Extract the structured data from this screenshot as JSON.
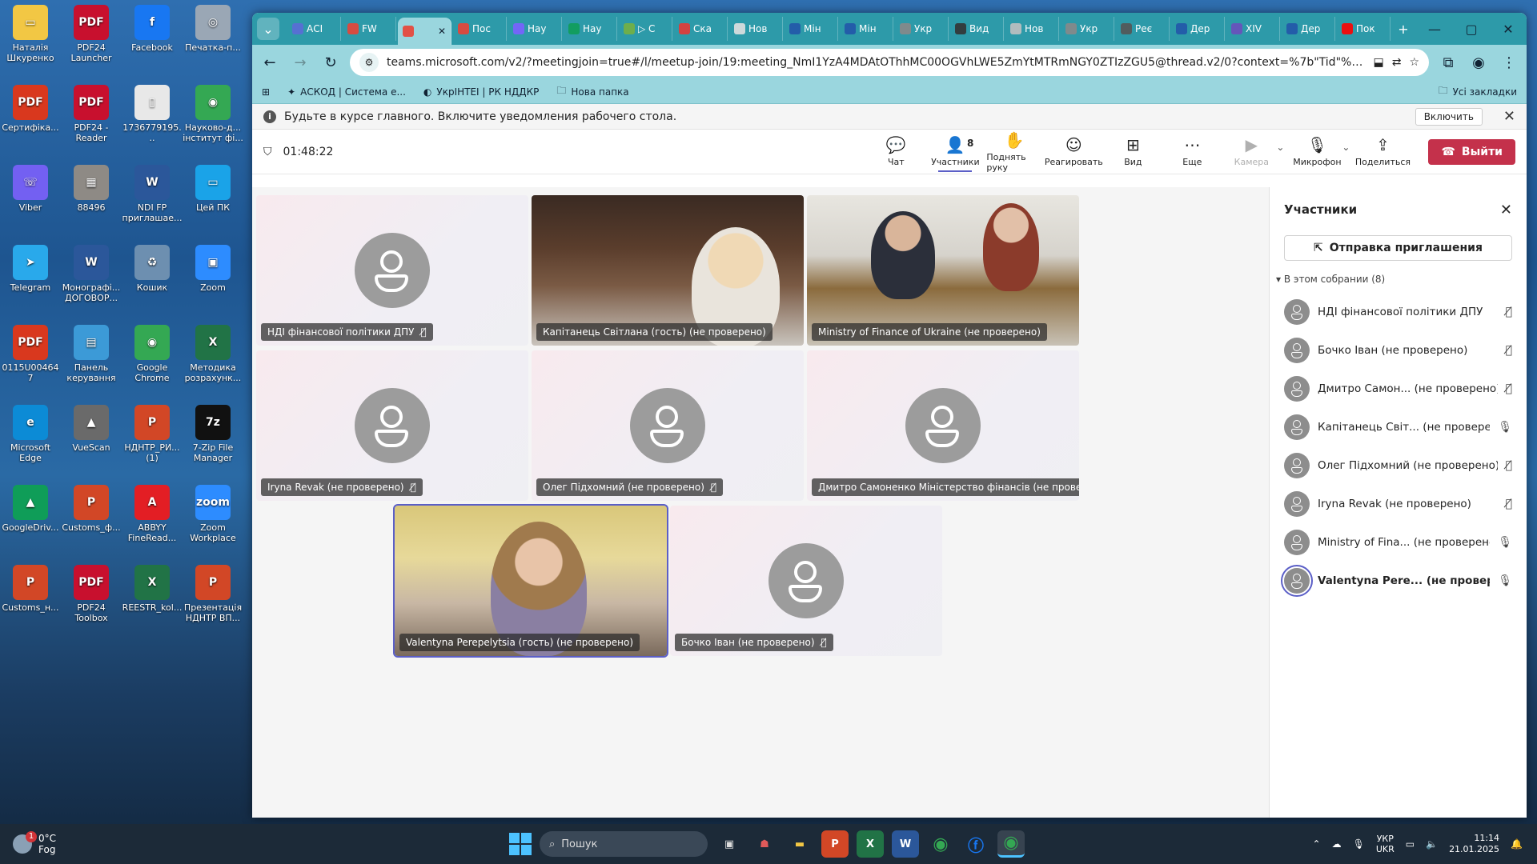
{
  "desktop": {
    "icons": [
      {
        "label": "Наталія Шкуренко",
        "glyph": "▭",
        "color": "#f2c744"
      },
      {
        "label": "PDF24 Launcher",
        "glyph": "PDF",
        "color": "#c8102e"
      },
      {
        "label": "Facebook",
        "glyph": "f",
        "color": "#1877f2"
      },
      {
        "label": "Печатка-п...",
        "glyph": "◎",
        "color": "#9aa7b5"
      },
      {
        "label": "Сертифіка...",
        "glyph": "PDF",
        "color": "#d9381e"
      },
      {
        "label": "PDF24 -Reader",
        "glyph": "PDF",
        "color": "#c8102e"
      },
      {
        "label": "1736779195...",
        "glyph": "▯",
        "color": "#e8e8e8"
      },
      {
        "label": "Науково-д... інститут фі...",
        "glyph": "◉",
        "color": "#34a853"
      },
      {
        "label": "Viber",
        "glyph": "☏",
        "color": "#7360f2"
      },
      {
        "label": "88496",
        "glyph": "▦",
        "color": "#8e8a85"
      },
      {
        "label": "NDI FP приглашае...",
        "glyph": "W",
        "color": "#2b579a"
      },
      {
        "label": "Цей ПК",
        "glyph": "▭",
        "color": "#1aa3e8"
      },
      {
        "label": "Telegram",
        "glyph": "➤",
        "color": "#29a9eb"
      },
      {
        "label": "Монографі... ДОГОВОР...",
        "glyph": "W",
        "color": "#2b579a"
      },
      {
        "label": "Кошик",
        "glyph": "♻",
        "color": "#6d8fb0"
      },
      {
        "label": "Zoom",
        "glyph": "▣",
        "color": "#2d8cff"
      },
      {
        "label": "0115U004647",
        "glyph": "PDF",
        "color": "#d9381e"
      },
      {
        "label": "Панель керування",
        "glyph": "▤",
        "color": "#3c9ad7"
      },
      {
        "label": "Google Chrome",
        "glyph": "◉",
        "color": "#34a853"
      },
      {
        "label": "Методика розрахунк...",
        "glyph": "X",
        "color": "#217346"
      },
      {
        "label": "Microsoft Edge",
        "glyph": "e",
        "color": "#0c8bd6"
      },
      {
        "label": "VueScan",
        "glyph": "▲",
        "color": "#6a6a6a"
      },
      {
        "label": "НДНТР_РИ... (1)",
        "glyph": "P",
        "color": "#d24726"
      },
      {
        "label": "7-Zip File Manager",
        "glyph": "7z",
        "color": "#111111"
      },
      {
        "label": "GoogleDriv...",
        "glyph": "▲",
        "color": "#0f9d58"
      },
      {
        "label": "Customs_ф...",
        "glyph": "P",
        "color": "#d24726"
      },
      {
        "label": "ABBYY FineRead...",
        "glyph": "A",
        "color": "#e31e24"
      },
      {
        "label": "Zoom Workplace",
        "glyph": "zoom",
        "color": "#2d8cff"
      },
      {
        "label": "Customs_н...",
        "glyph": "P",
        "color": "#d24726"
      },
      {
        "label": "PDF24 Toolbox",
        "glyph": "PDF",
        "color": "#c8102e"
      },
      {
        "label": "REESTR_kol...",
        "glyph": "X",
        "color": "#217346"
      },
      {
        "label": "Презентація НДНТР ВП...",
        "glyph": "P",
        "color": "#d24726"
      }
    ]
  },
  "browser": {
    "tabs": [
      "АСІ",
      "FW",
      "",
      "Пос",
      "Нау",
      "Нау",
      "▷ С",
      "Ска",
      "Нов",
      "Мін",
      "Мін",
      "Укр",
      "Вид",
      "Нов",
      "Укр",
      "Реє",
      "Дер",
      "XIV",
      "Дер",
      "Пок"
    ],
    "active_tab_index": 2,
    "url": "teams.microsoft.com/v2/?meetingjoin=true#/l/meetup-join/19:meeting_NmI1YzA4MDAtOThhMC00OGVhLWE5ZmYtMTRmNGY0ZTIzZGU5@thread.v2/0?context=%7b\"Tid\"%3a\"75ae0276-ee1...",
    "bookmarks": [
      "АСКОД | Система е...",
      "УкрІНТЕІ | РК НДДКР",
      "Нова папка"
    ],
    "all_bookmarks": "Усі закладки"
  },
  "notification": {
    "text": "Будьте в курсе главного. Включите уведомления рабочего стола.",
    "button": "Включить"
  },
  "toolbar": {
    "timer": "01:48:22",
    "chat": "Чат",
    "participants": "Участники",
    "participants_count": "8",
    "raise_hand": "Поднять руку",
    "react": "Реагировать",
    "view": "Вид",
    "more": "Еще",
    "camera": "Камера",
    "mic": "Микрофон",
    "share": "Поделиться",
    "leave": "Выйти"
  },
  "tiles": [
    {
      "name": "НДІ фінансової політики ДПУ",
      "type": "avatar",
      "muted": true
    },
    {
      "name": "Капітанець Світлана (гость) (не проверено)",
      "type": "video1",
      "muted": false
    },
    {
      "name": "Ministry of Finance of Ukraine (не проверено)",
      "type": "video2",
      "muted": false
    },
    {
      "name": "Iryna Revak (не проверено)",
      "type": "avatar",
      "muted": true
    },
    {
      "name": "Олег Підхомний (не проверено)",
      "type": "avatar",
      "muted": true
    },
    {
      "name": "Дмитро Самоненко Міністерство фінансів (не проверено)",
      "type": "avatar",
      "muted": true
    },
    {
      "name": "Valentyna Perepelytsia (гость) (не проверено)",
      "type": "video3",
      "muted": false
    },
    {
      "name": "Бочко Іван (не проверено)",
      "type": "avatar",
      "muted": true
    }
  ],
  "panel": {
    "title": "Участники",
    "invite": "Отправка приглашения",
    "section": "В этом собрании (8)",
    "participants": [
      {
        "name": "НДІ фінансової політики ДПУ",
        "muted": true
      },
      {
        "name": "Бочко Іван (не проверено)",
        "muted": true
      },
      {
        "name": "Дмитро Самон...  (не проверено)",
        "muted": true
      },
      {
        "name": "Капітанець Світ...  (не проверено)",
        "muted": false
      },
      {
        "name": "Олег Підхомний (не проверено)",
        "muted": true
      },
      {
        "name": "Iryna Revak (не проверено)",
        "muted": true
      },
      {
        "name": "Ministry of Fina...  (не проверено)",
        "muted": false
      },
      {
        "name": "Valentyna Pere...  (не проверено)",
        "muted": false,
        "me": true
      }
    ]
  },
  "taskbar": {
    "temp": "0°C",
    "weather": "Fog",
    "weather_badge": "1",
    "search": "Пошук",
    "lang1": "УКР",
    "lang2": "UKR",
    "time": "11:14",
    "date": "21.01.2025"
  }
}
